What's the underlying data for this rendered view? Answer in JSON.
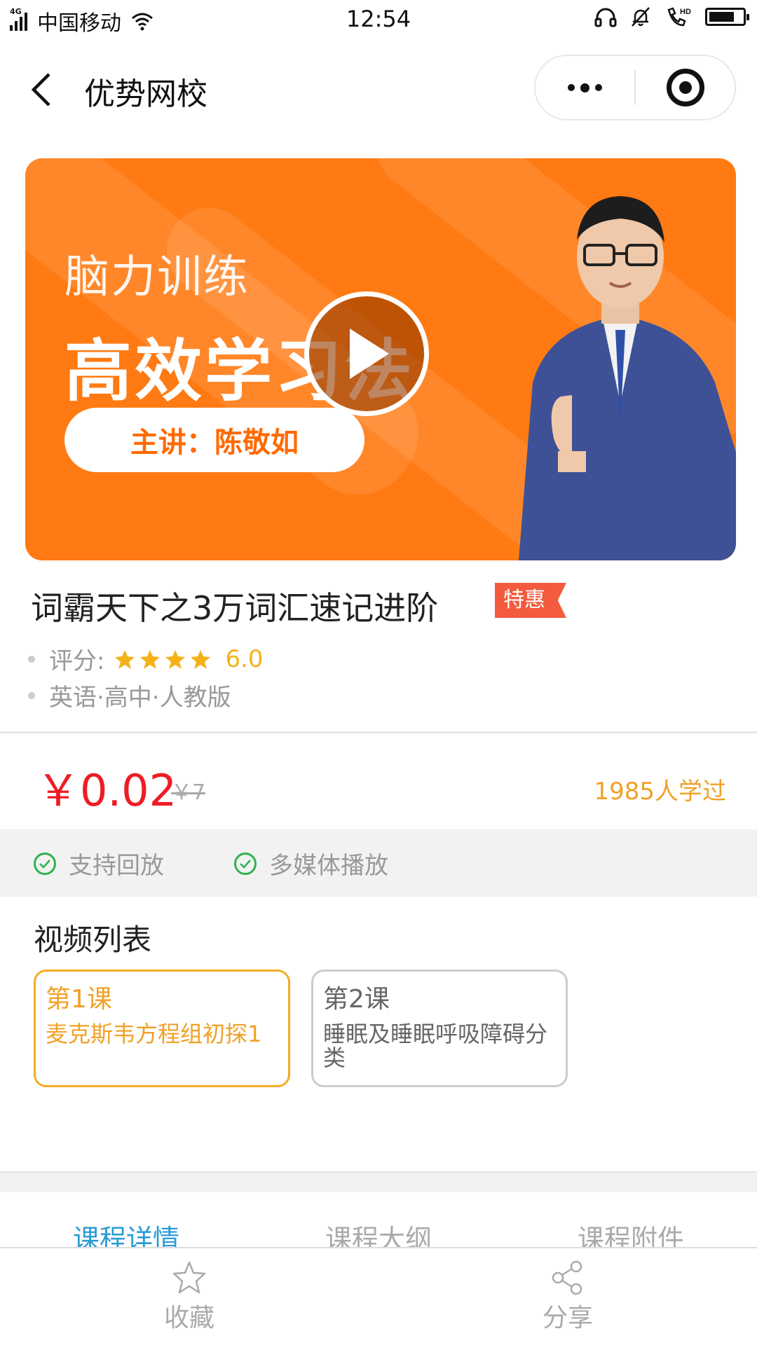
{
  "status_bar": {
    "network": "4G",
    "carrier": "中国移动",
    "time": "12:54",
    "hd_label": "HD",
    "battery_level": 0.75
  },
  "nav": {
    "title": "优势网校",
    "back_icon": "chevron-left-icon",
    "more_icon": "more-dots-icon",
    "close_icon": "target-circle-icon"
  },
  "banner": {
    "subtitle": "脑力训练",
    "headline": "高效学习法",
    "lecturer": "主讲：陈敬如",
    "play_icon": "play-icon",
    "colors": {
      "background": "#ff7a12",
      "pill_text": "#ff6a00"
    }
  },
  "course": {
    "title": "词霸天下之3万词汇速记进阶",
    "badge": "特惠",
    "rating_label": "评分:",
    "rating_stars": 4,
    "rating_score": "6.0",
    "category": "英语·高中·人教版"
  },
  "pricing": {
    "price": "￥0.02",
    "original_price": "￥7",
    "learners": "1985人学过"
  },
  "features": [
    {
      "label": "支持回放",
      "icon": "check-circle-icon"
    },
    {
      "label": "多媒体播放",
      "icon": "check-circle-icon"
    }
  ],
  "video_list": {
    "title": "视频列表",
    "lessons": [
      {
        "number": "第1课",
        "name": "麦克斯韦方程组初探1",
        "active": true
      },
      {
        "number": "第2课",
        "name": "睡眠及睡眠呼吸障碍分类",
        "active": false
      }
    ]
  },
  "tabs": [
    {
      "label": "课程详情",
      "active": true
    },
    {
      "label": "课程大纲",
      "active": false
    },
    {
      "label": "课程附件",
      "active": false
    }
  ],
  "bottom_bar": {
    "favorite_label": "收藏",
    "favorite_icon": "star-outline-icon",
    "share_label": "分享",
    "share_icon": "share-icon"
  },
  "colors": {
    "price_red": "#ee1c25",
    "accent_orange": "#f0a127",
    "tab_active_blue": "#2a9bd6",
    "check_green": "#2fb24e",
    "badge_red": "#f25b3d"
  }
}
